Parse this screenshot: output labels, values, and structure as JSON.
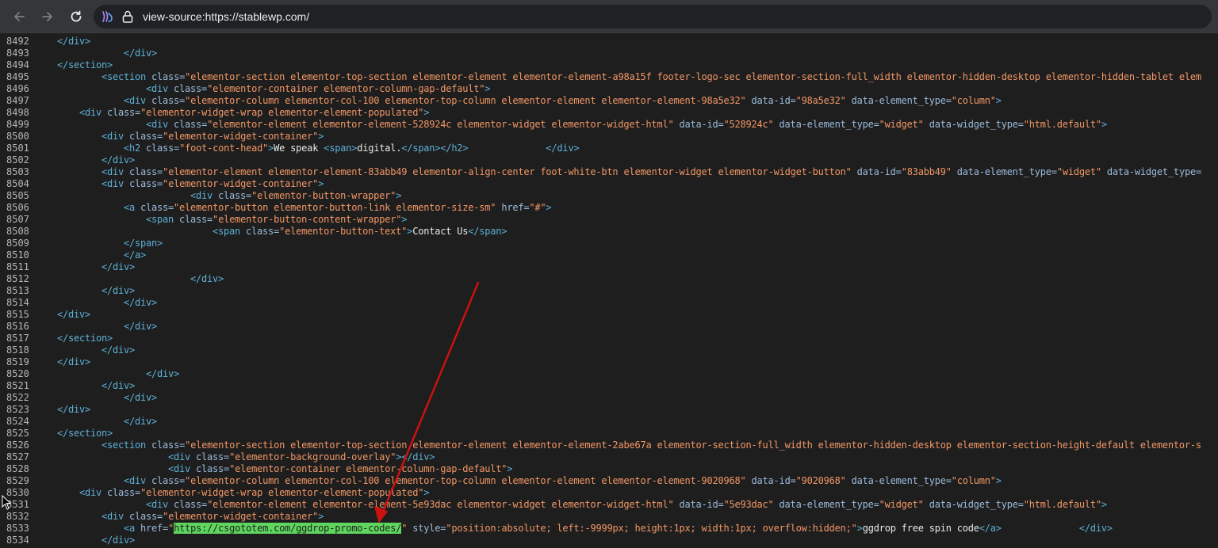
{
  "browser": {
    "url": "view-source:https://stablewp.com/",
    "accent_color": "#cc1111",
    "highlight_color": "#5fd75f"
  },
  "source_lines": [
    {
      "n": "8492",
      "indent": 3,
      "tokens": [
        [
          "t",
          "</div>"
        ]
      ]
    },
    {
      "n": "8493",
      "indent": 9,
      "tokens": [
        [
          "t",
          "</div>"
        ]
      ]
    },
    {
      "n": "8494",
      "indent": 3,
      "tokens": [
        [
          "t",
          "</section>"
        ]
      ]
    },
    {
      "n": "8495",
      "indent": 7,
      "tokens": [
        [
          "t",
          "<section "
        ],
        [
          "a",
          "class="
        ],
        [
          "v",
          "\"elementor-section elementor-top-section elementor-element elementor-element-a98a15f footer-logo-sec elementor-section-full_width elementor-hidden-desktop elementor-hidden-tablet elem"
        ]
      ]
    },
    {
      "n": "8496",
      "indent": 11,
      "tokens": [
        [
          "t",
          "<div "
        ],
        [
          "a",
          "class="
        ],
        [
          "v",
          "\"elementor-container elementor-column-gap-default\""
        ],
        [
          "t",
          ">"
        ]
      ]
    },
    {
      "n": "8497",
      "indent": 9,
      "tokens": [
        [
          "t",
          "<div "
        ],
        [
          "a",
          "class="
        ],
        [
          "v",
          "\"elementor-column elementor-col-100 elementor-top-column elementor-element elementor-element-98a5e32\""
        ],
        [
          "a",
          " data-id="
        ],
        [
          "v",
          "\"98a5e32\""
        ],
        [
          "a",
          " data-element_type="
        ],
        [
          "v",
          "\"column\""
        ],
        [
          "t",
          ">"
        ]
      ]
    },
    {
      "n": "8498",
      "indent": 5,
      "tokens": [
        [
          "t",
          "<div "
        ],
        [
          "a",
          "class="
        ],
        [
          "v",
          "\"elementor-widget-wrap elementor-element-populated\""
        ],
        [
          "t",
          ">"
        ]
      ]
    },
    {
      "n": "8499",
      "indent": 11,
      "tokens": [
        [
          "t",
          "<div "
        ],
        [
          "a",
          "class="
        ],
        [
          "v",
          "\"elementor-element elementor-element-528924c elementor-widget elementor-widget-html\""
        ],
        [
          "a",
          " data-id="
        ],
        [
          "v",
          "\"528924c\""
        ],
        [
          "a",
          " data-element_type="
        ],
        [
          "v",
          "\"widget\""
        ],
        [
          "a",
          " data-widget_type="
        ],
        [
          "v",
          "\"html.default\""
        ],
        [
          "t",
          ">"
        ]
      ]
    },
    {
      "n": "8500",
      "indent": 7,
      "tokens": [
        [
          "t",
          "<div "
        ],
        [
          "a",
          "class="
        ],
        [
          "v",
          "\"elementor-widget-container\""
        ],
        [
          "t",
          ">"
        ]
      ]
    },
    {
      "n": "8501",
      "indent": 9,
      "tokens": [
        [
          "t",
          "<h2 "
        ],
        [
          "a",
          "class="
        ],
        [
          "v",
          "\"foot-cont-head\""
        ],
        [
          "t",
          ">"
        ],
        [
          "x",
          "We speak "
        ],
        [
          "t",
          "<span>"
        ],
        [
          "x",
          "digital."
        ],
        [
          "t",
          "</span></h2>"
        ],
        [
          "x",
          "              "
        ],
        [
          "t",
          "</div>"
        ]
      ]
    },
    {
      "n": "8502",
      "indent": 7,
      "tokens": [
        [
          "t",
          "</div>"
        ]
      ]
    },
    {
      "n": "8503",
      "indent": 7,
      "tokens": [
        [
          "t",
          "<div "
        ],
        [
          "a",
          "class="
        ],
        [
          "v",
          "\"elementor-element elementor-element-83abb49 elementor-align-center foot-white-btn elementor-widget elementor-widget-button\""
        ],
        [
          "a",
          " data-id="
        ],
        [
          "v",
          "\"83abb49\""
        ],
        [
          "a",
          " data-element_type="
        ],
        [
          "v",
          "\"widget\""
        ],
        [
          "a",
          " data-widget_type="
        ]
      ]
    },
    {
      "n": "8504",
      "indent": 7,
      "tokens": [
        [
          "t",
          "<div "
        ],
        [
          "a",
          "class="
        ],
        [
          "v",
          "\"elementor-widget-container\""
        ],
        [
          "t",
          ">"
        ]
      ]
    },
    {
      "n": "8505",
      "indent": 15,
      "tokens": [
        [
          "t",
          "<div "
        ],
        [
          "a",
          "class="
        ],
        [
          "v",
          "\"elementor-button-wrapper\""
        ],
        [
          "t",
          ">"
        ]
      ]
    },
    {
      "n": "8506",
      "indent": 9,
      "tokens": [
        [
          "t",
          "<a "
        ],
        [
          "a",
          "class="
        ],
        [
          "v",
          "\"elementor-button elementor-button-link elementor-size-sm\""
        ],
        [
          "a",
          " href="
        ],
        [
          "v",
          "\"#\""
        ],
        [
          "t",
          ">"
        ]
      ]
    },
    {
      "n": "8507",
      "indent": 11,
      "tokens": [
        [
          "t",
          "<span "
        ],
        [
          "a",
          "class="
        ],
        [
          "v",
          "\"elementor-button-content-wrapper\""
        ],
        [
          "t",
          ">"
        ]
      ]
    },
    {
      "n": "8508",
      "indent": 17,
      "tokens": [
        [
          "t",
          "<span "
        ],
        [
          "a",
          "class="
        ],
        [
          "v",
          "\"elementor-button-text\""
        ],
        [
          "t",
          ">"
        ],
        [
          "x",
          "Contact Us"
        ],
        [
          "t",
          "</span>"
        ]
      ]
    },
    {
      "n": "8509",
      "indent": 9,
      "tokens": [
        [
          "t",
          "</span>"
        ]
      ]
    },
    {
      "n": "8510",
      "indent": 9,
      "tokens": [
        [
          "t",
          "</a>"
        ]
      ]
    },
    {
      "n": "8511",
      "indent": 7,
      "tokens": [
        [
          "t",
          "</div>"
        ]
      ]
    },
    {
      "n": "8512",
      "indent": 15,
      "tokens": [
        [
          "t",
          "</div>"
        ]
      ]
    },
    {
      "n": "8513",
      "indent": 7,
      "tokens": [
        [
          "t",
          "</div>"
        ]
      ]
    },
    {
      "n": "8514",
      "indent": 9,
      "tokens": [
        [
          "t",
          "</div>"
        ]
      ]
    },
    {
      "n": "8515",
      "indent": 3,
      "tokens": [
        [
          "t",
          "</div>"
        ]
      ]
    },
    {
      "n": "8516",
      "indent": 9,
      "tokens": [
        [
          "t",
          "</div>"
        ]
      ]
    },
    {
      "n": "8517",
      "indent": 3,
      "tokens": [
        [
          "t",
          "</section>"
        ]
      ]
    },
    {
      "n": "8518",
      "indent": 7,
      "tokens": [
        [
          "t",
          "</div>"
        ]
      ]
    },
    {
      "n": "8519",
      "indent": 3,
      "tokens": [
        [
          "t",
          "</div>"
        ]
      ]
    },
    {
      "n": "8520",
      "indent": 11,
      "tokens": [
        [
          "t",
          "</div>"
        ]
      ]
    },
    {
      "n": "8521",
      "indent": 7,
      "tokens": [
        [
          "t",
          "</div>"
        ]
      ]
    },
    {
      "n": "8522",
      "indent": 9,
      "tokens": [
        [
          "t",
          "</div>"
        ]
      ]
    },
    {
      "n": "8523",
      "indent": 3,
      "tokens": [
        [
          "t",
          "</div>"
        ]
      ]
    },
    {
      "n": "8524",
      "indent": 9,
      "tokens": [
        [
          "t",
          "</div>"
        ]
      ]
    },
    {
      "n": "8525",
      "indent": 3,
      "tokens": [
        [
          "t",
          "</section>"
        ]
      ]
    },
    {
      "n": "8526",
      "indent": 7,
      "tokens": [
        [
          "t",
          "<section "
        ],
        [
          "a",
          "class="
        ],
        [
          "v",
          "\"elementor-section elementor-top-section elementor-element elementor-element-2abe67a elementor-section-full_width elementor-hidden-desktop elementor-section-height-default elementor-s"
        ]
      ]
    },
    {
      "n": "8527",
      "indent": 13,
      "tokens": [
        [
          "t",
          "<div "
        ],
        [
          "a",
          "class="
        ],
        [
          "v",
          "\"elementor-background-overlay\""
        ],
        [
          "t",
          "></div>"
        ]
      ]
    },
    {
      "n": "8528",
      "indent": 13,
      "tokens": [
        [
          "t",
          "<div "
        ],
        [
          "a",
          "class="
        ],
        [
          "v",
          "\"elementor-container elementor-column-gap-default\""
        ],
        [
          "t",
          ">"
        ]
      ]
    },
    {
      "n": "8529",
      "indent": 9,
      "tokens": [
        [
          "t",
          "<div "
        ],
        [
          "a",
          "class="
        ],
        [
          "v",
          "\"elementor-column elementor-col-100 elementor-top-column elementor-element elementor-element-9020968\""
        ],
        [
          "a",
          " data-id="
        ],
        [
          "v",
          "\"9020968\""
        ],
        [
          "a",
          " data-element_type="
        ],
        [
          "v",
          "\"column\""
        ],
        [
          "t",
          ">"
        ]
      ]
    },
    {
      "n": "8530",
      "indent": 5,
      "tokens": [
        [
          "t",
          "<div "
        ],
        [
          "a",
          "class="
        ],
        [
          "v",
          "\"elementor-widget-wrap elementor-element-populated\""
        ],
        [
          "t",
          ">"
        ]
      ]
    },
    {
      "n": "8531",
      "indent": 11,
      "tokens": [
        [
          "t",
          "<div "
        ],
        [
          "a",
          "class="
        ],
        [
          "v",
          "\"elementor-element elementor-element-5e93dac elementor-widget elementor-widget-html\""
        ],
        [
          "a",
          " data-id="
        ],
        [
          "v",
          "\"5e93dac\""
        ],
        [
          "a",
          " data-element_type="
        ],
        [
          "v",
          "\"widget\""
        ],
        [
          "a",
          " data-widget_type="
        ],
        [
          "v",
          "\"html.default\""
        ],
        [
          "t",
          ">"
        ]
      ]
    },
    {
      "n": "8532",
      "indent": 7,
      "tokens": [
        [
          "t",
          "<div "
        ],
        [
          "a",
          "class="
        ],
        [
          "v",
          "\"elementor-widget-container\""
        ],
        [
          "t",
          ">"
        ]
      ]
    },
    {
      "n": "8533",
      "indent": 9,
      "tokens": [
        [
          "t",
          "<a "
        ],
        [
          "a",
          "href="
        ],
        [
          "v",
          "\""
        ],
        [
          "h",
          "https://csgototem.com/ggdrop-promo-codes/"
        ],
        [
          "v",
          "\""
        ],
        [
          "a",
          " style="
        ],
        [
          "v",
          "\"position:absolute; left:-9999px; height:1px; width:1px; overflow:hidden;\""
        ],
        [
          "t",
          ">"
        ],
        [
          "x",
          "ggdrop free spin code"
        ],
        [
          "t",
          "</a>"
        ],
        [
          "x",
          "              "
        ],
        [
          "t",
          "</div>"
        ]
      ]
    },
    {
      "n": "8534",
      "indent": 7,
      "tokens": [
        [
          "t",
          "</div>"
        ]
      ]
    }
  ]
}
